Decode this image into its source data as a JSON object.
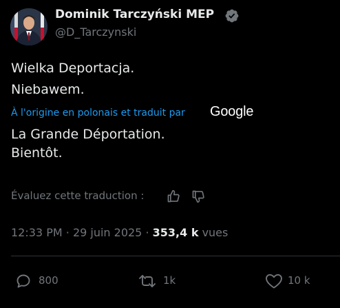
{
  "author": {
    "display_name": "Dominik Tarczyński MEP",
    "handle": "@D_Tarczynski",
    "verified": true,
    "verified_color": "#71767b"
  },
  "tweet": {
    "original_lines": [
      "Wielka Deportacja.",
      "Niebawem."
    ],
    "translation_note": "À l'origine en polonais et traduit par",
    "translation_provider": "Google",
    "translated_lines": [
      "La Grande Déportation.",
      "Bientôt."
    ]
  },
  "rating": {
    "label": "Évaluez cette traduction :",
    "thumbs_up_icon": "thumbs-up-icon",
    "thumbs_down_icon": "thumbs-down-icon"
  },
  "meta": {
    "time": "12:33 PM",
    "separator": "·",
    "date": "29 juin 2025",
    "views_count": "353,4 k",
    "views_label": "vues"
  },
  "actions": {
    "replies": "800",
    "reposts": "1k",
    "likes": "10 k"
  },
  "colors": {
    "background": "#000000",
    "text": "#e7e9ea",
    "secondary": "#71767b",
    "link": "#1d9bf0",
    "divider": "#2f3336"
  }
}
